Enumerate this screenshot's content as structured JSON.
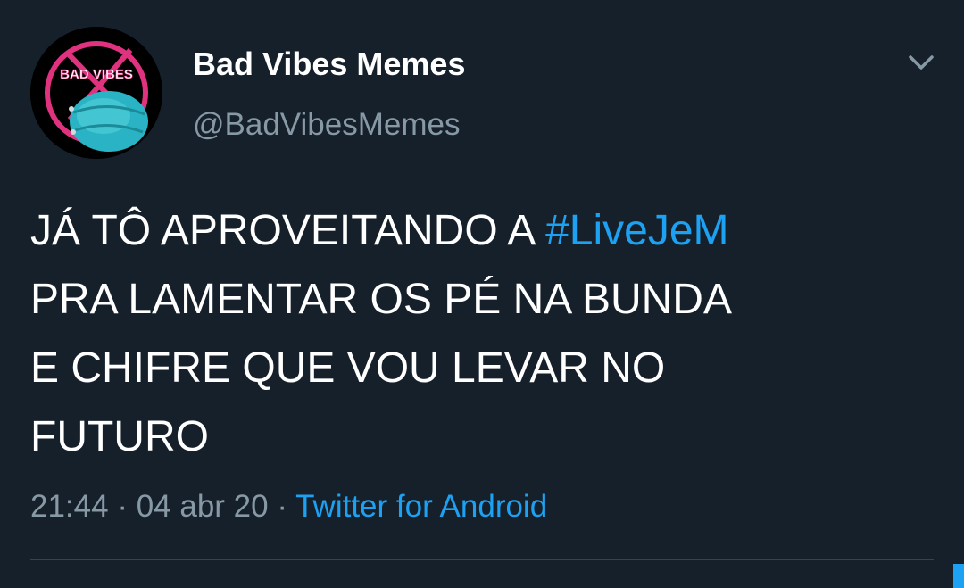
{
  "tweet": {
    "author": {
      "display_name": "Bad Vibes Memes",
      "handle": "@BadVibesMemes",
      "avatar_text": "BAD VIBES"
    },
    "text_lines": [
      {
        "before": "JÁ TÔ APROVEITANDO A ",
        "hashtag": "#LiveJeM"
      },
      {
        "text": "PRA LAMENTAR OS PÉ NA BUNDA"
      },
      {
        "text": "E CHIFRE QUE VOU LEVAR NO"
      },
      {
        "text": "FUTURO"
      }
    ],
    "time": "21:44",
    "date": "04 abr 20",
    "separator": "·",
    "source": "Twitter for Android",
    "menu_icon": "chevron-down-icon"
  },
  "colors": {
    "background": "#15202b",
    "text": "#ffffff",
    "secondary_text": "#8899a6",
    "link": "#1da1f2",
    "divider": "#38444d"
  }
}
